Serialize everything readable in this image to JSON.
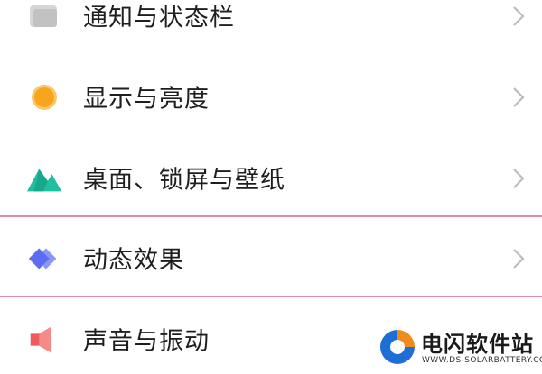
{
  "settings": {
    "items": [
      {
        "label": "通知与状态栏",
        "icon": "notification-status-icon",
        "color": "#bdbdbd"
      },
      {
        "label": "显示与亮度",
        "icon": "brightness-icon",
        "color": "#f7a51e"
      },
      {
        "label": "桌面、锁屏与壁纸",
        "icon": "wallpaper-icon",
        "color": "#1fc0a0"
      },
      {
        "label": "动态效果",
        "icon": "animation-effects-icon",
        "color": "#5b6ef2"
      },
      {
        "label": "声音与振动",
        "icon": "sound-vibration-icon",
        "color": "#f05a5a"
      }
    ]
  },
  "colors": {
    "highlight": "#e38ab0",
    "chevron": "#bcbcbc",
    "text": "#1e1e1e"
  },
  "watermark": {
    "name": "电闪软件站",
    "url": "WWW.DS-SOLARBATTERY.COM"
  }
}
